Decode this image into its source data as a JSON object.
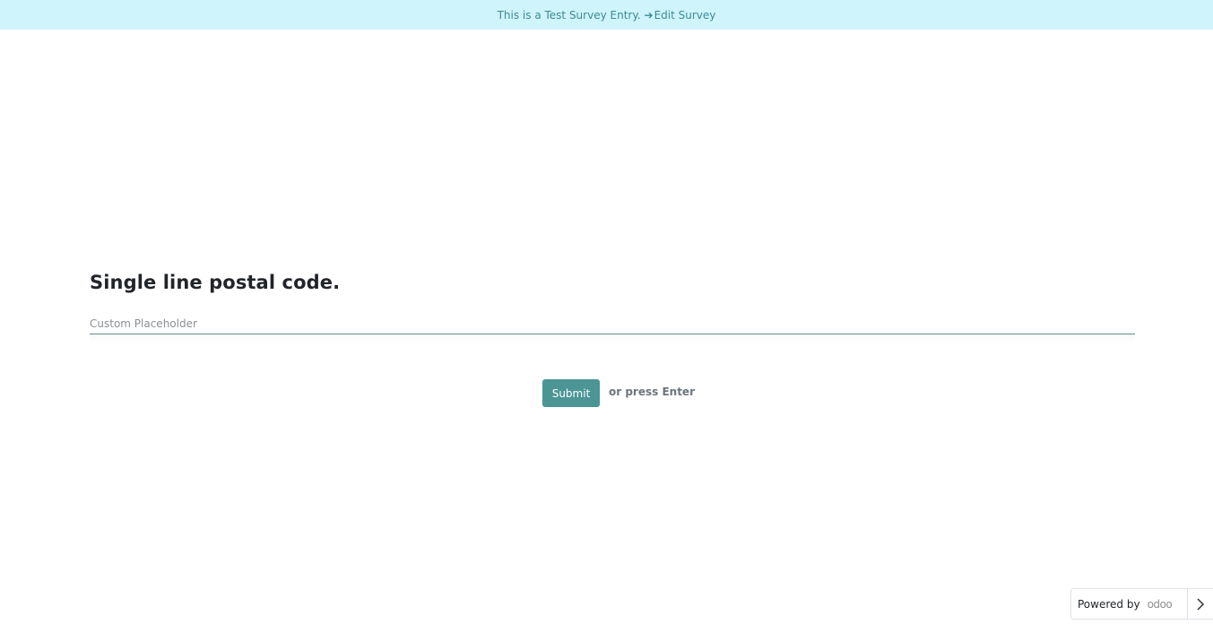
{
  "banner": {
    "text": "This is a Test Survey Entry.",
    "arrow_icon": "arrow-right-icon",
    "edit_label": "Edit Survey",
    "background": "#cff4fc",
    "color": "#3d8a94"
  },
  "question": {
    "title": "Single line postal code.",
    "placeholder": "Custom Placeholder",
    "value": ""
  },
  "actions": {
    "submit_label": "Submit",
    "hint": "or press Enter",
    "accent": "#4b9595"
  },
  "footer": {
    "powered_by": "Powered by",
    "logo_text": "odoo",
    "chevron_icon": "chevron-right-icon"
  }
}
